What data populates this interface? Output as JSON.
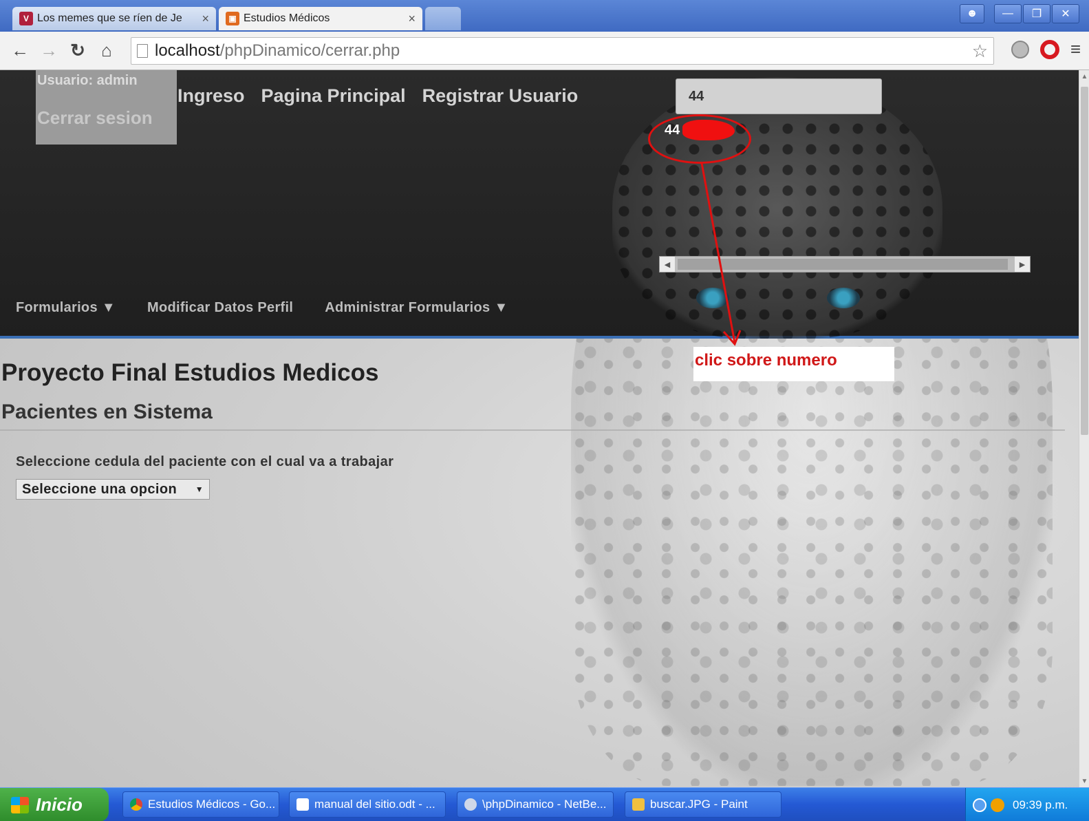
{
  "browser": {
    "tabs": [
      {
        "title": "Los memes que se ríen de Je",
        "active": false
      },
      {
        "title": "Estudios Médicos",
        "active": true
      }
    ],
    "close_glyph": "×",
    "url_host": "localhost",
    "url_path": "/phpDinamico/cerrar.php"
  },
  "header": {
    "user_label": "Usuario: admin",
    "logout_label": "Cerrar sesion",
    "nav": [
      "Ingreso",
      "Pagina Principal",
      "Registrar Usuario"
    ],
    "search_value": "44",
    "suggestion": "44",
    "menu": {
      "forms": "Formularios",
      "edit_profile": "Modificar Datos Perfil",
      "admin_forms": "Administrar Formularios"
    }
  },
  "annotation": {
    "note": "clic sobre numero",
    "color": "#e01010"
  },
  "content": {
    "page_title": "Proyecto Final Estudios Medicos",
    "section_title": "Pacientes en Sistema",
    "field_label": "Seleccione cedula del paciente con el cual va a trabajar",
    "select_value": "Seleccione una opcion"
  },
  "taskbar": {
    "start_label": "Inicio",
    "tasks": [
      "Estudios Médicos - Go...",
      "manual del sitio.odt - ...",
      "\\phpDinamico - NetBe...",
      "buscar.JPG - Paint"
    ],
    "clock": "09:39 p.m."
  },
  "colors": {
    "accent_blue": "#3a6fb5",
    "xp_taskbar": "#2459d4",
    "annotation_red": "#e01010"
  }
}
